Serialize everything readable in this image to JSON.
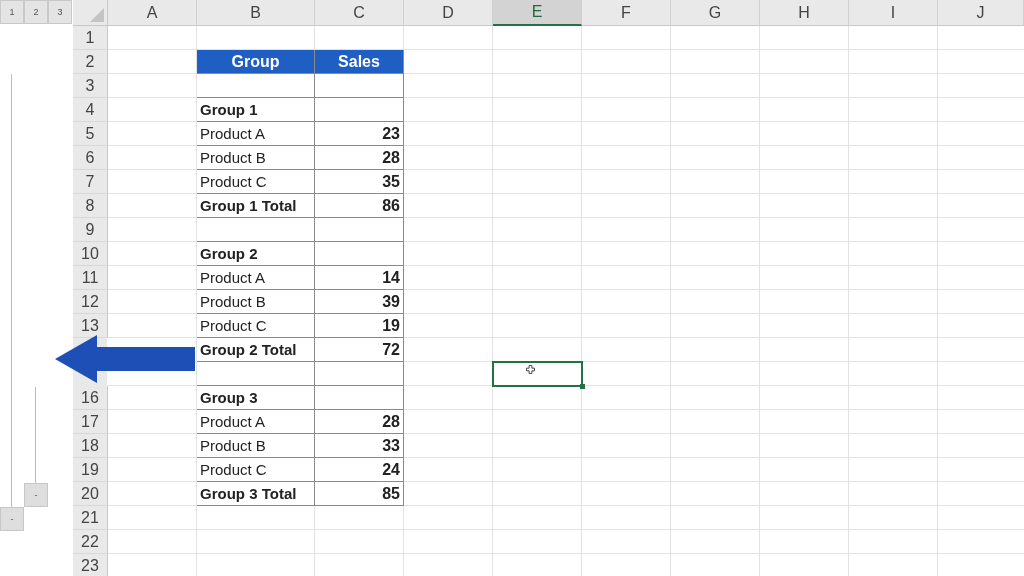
{
  "outline": {
    "level_buttons": [
      "1",
      "2",
      "3"
    ],
    "collapse_buttons": [
      {
        "label": "-"
      },
      {
        "label": "-"
      }
    ]
  },
  "columns": [
    {
      "label": "A",
      "selected": false
    },
    {
      "label": "B",
      "selected": false
    },
    {
      "label": "C",
      "selected": false
    },
    {
      "label": "D",
      "selected": false
    },
    {
      "label": "E",
      "selected": true
    },
    {
      "label": "F",
      "selected": false
    },
    {
      "label": "G",
      "selected": false
    },
    {
      "label": "H",
      "selected": false
    },
    {
      "label": "I",
      "selected": false
    },
    {
      "label": "J",
      "selected": false
    }
  ],
  "rows": [
    {
      "label": "1",
      "selected": false
    },
    {
      "label": "2",
      "selected": false
    },
    {
      "label": "3",
      "selected": false
    },
    {
      "label": "4",
      "selected": false
    },
    {
      "label": "5",
      "selected": false
    },
    {
      "label": "6",
      "selected": false
    },
    {
      "label": "7",
      "selected": false
    },
    {
      "label": "8",
      "selected": false
    },
    {
      "label": "9",
      "selected": false
    },
    {
      "label": "10",
      "selected": false
    },
    {
      "label": "11",
      "selected": false
    },
    {
      "label": "12",
      "selected": false
    },
    {
      "label": "13",
      "selected": false
    },
    {
      "selected": false
    },
    {
      "selected": true
    },
    {
      "label": "16",
      "selected": false
    },
    {
      "label": "17",
      "selected": false
    },
    {
      "label": "18",
      "selected": false
    },
    {
      "label": "19",
      "selected": false
    },
    {
      "label": "20",
      "selected": false
    },
    {
      "label": "21",
      "selected": false
    },
    {
      "label": "22",
      "selected": false
    },
    {
      "label": "23",
      "selected": false
    }
  ],
  "table": {
    "columns": [
      "Group",
      "Sales"
    ],
    "rows": [
      {
        "bold": false
      },
      {
        "group": "Group 1",
        "bold": true
      },
      {
        "group": "Product A",
        "sales": "23",
        "bold": false
      },
      {
        "group": "Product B",
        "sales": "28",
        "bold": false
      },
      {
        "group": "Product C",
        "sales": "35",
        "bold": false
      },
      {
        "group": "Group 1 Total",
        "sales": "86",
        "bold": true
      },
      {
        "bold": false
      },
      {
        "group": "Group 2",
        "bold": true
      },
      {
        "group": "Product A",
        "sales": "14",
        "bold": false
      },
      {
        "group": "Product B",
        "sales": "39",
        "bold": false
      },
      {
        "group": "Product C",
        "sales": "19",
        "bold": false
      },
      {
        "group": "Group 2 Total",
        "sales": "72",
        "bold": true
      },
      {
        "bold": false
      },
      {
        "group": "Group 3",
        "bold": true
      },
      {
        "group": "Product A",
        "sales": "28",
        "bold": false
      },
      {
        "group": "Product B",
        "sales": "33",
        "bold": false
      },
      {
        "group": "Product C",
        "sales": "24",
        "bold": false
      },
      {
        "group": "Group 3 Total",
        "sales": "85",
        "bold": true
      }
    ]
  }
}
